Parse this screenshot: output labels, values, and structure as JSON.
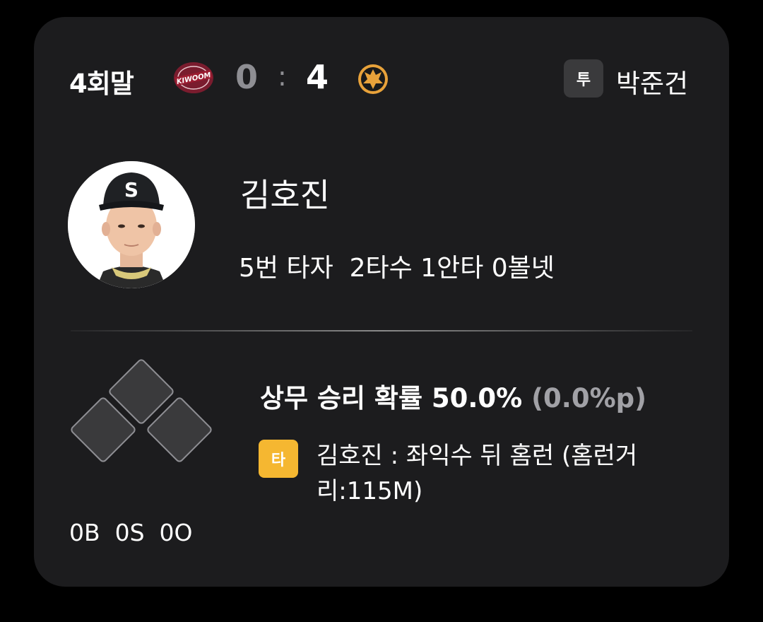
{
  "game": {
    "inning": "4회말",
    "away_score": "0",
    "separator": ":",
    "home_score": "4",
    "away_logo_text": "KIWOOM",
    "pitcher_badge": "투",
    "pitcher_name": "박준건"
  },
  "batter": {
    "cap_letter": "S",
    "name": "김호진",
    "stats": "5번 타자  2타수 1안타 0볼넷"
  },
  "situation": {
    "count": "0B  0S  0O",
    "win_prob_label": "상무 승리 확률 50.0%",
    "win_prob_delta": "(0.0%p)",
    "play_badge": "타",
    "play_text": "김호진 : 좌익수 뒤 홈런 (홈런거리:115M)"
  },
  "colors": {
    "card_bg": "#1c1c1e",
    "away_score": "#8e8e93",
    "play_badge": "#f5b731",
    "pitcher_badge": "#3a3a3c"
  }
}
